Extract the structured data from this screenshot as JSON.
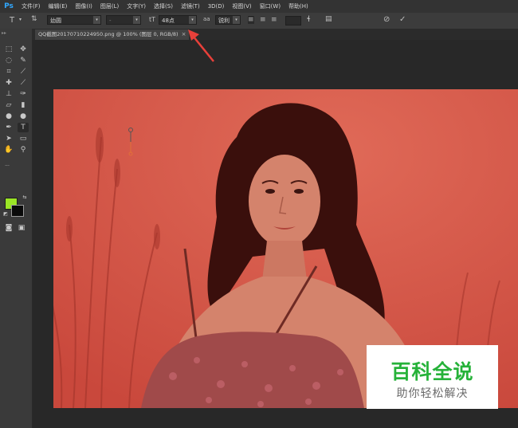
{
  "app": {
    "logo": "Ps"
  },
  "menubar": {
    "items": [
      "文件(F)",
      "编辑(E)",
      "图像(I)",
      "图层(L)",
      "文字(Y)",
      "选择(S)",
      "滤镜(T)",
      "3D(D)",
      "视图(V)",
      "窗口(W)",
      "帮助(H)"
    ]
  },
  "options": {
    "font_family": "幼圆",
    "font_style": "-",
    "font_size": "48点",
    "aa_label": "a",
    "aa_mode": "锐利"
  },
  "document": {
    "tab_title": "QQ截图20170710224950.png @ 100% (图层 0, RGB/8)",
    "close": "×"
  },
  "watermark": {
    "title": "百科全说",
    "subtitle": "助你轻松解决"
  },
  "colors": {
    "foreground": "#9be526",
    "background": "#0a0a0a",
    "overlay": "#d85a4a",
    "arrow": "#e8403a",
    "watermark_green": "#26b239"
  },
  "icons": [
    "type-tool-icon",
    "toggle-orientation-icon",
    "font-size-icon",
    "anti-alias-icon",
    "align-left-icon",
    "align-center-icon",
    "align-right-icon",
    "text-color-icon",
    "warp-text-icon",
    "character-panel-icon",
    "cancel-icon",
    "commit-icon",
    "annotation-arrow-icon"
  ]
}
